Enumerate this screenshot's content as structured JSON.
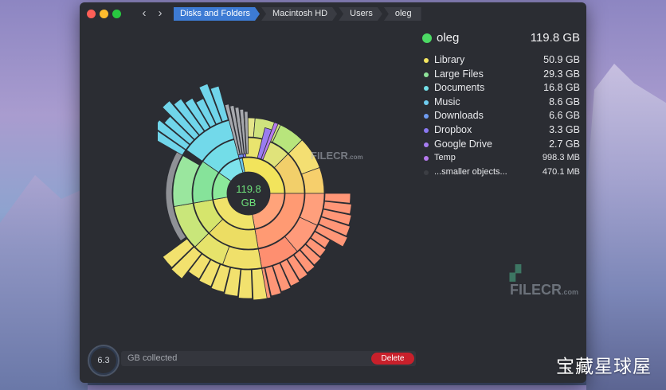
{
  "window": {
    "breadcrumbs": [
      "Disks and Folders",
      "Macintosh HD",
      "Users",
      "oleg"
    ],
    "back_icon": "chevron-left-icon",
    "forward_icon": "chevron-right-icon"
  },
  "chart": {
    "center_value": "119.8",
    "center_unit": "GB"
  },
  "legend": {
    "folder": {
      "name": "oleg",
      "size": "119.8 GB",
      "color": "#4cd964"
    },
    "items": [
      {
        "label": "Library",
        "size": "50.9 GB",
        "color": "#f5e660"
      },
      {
        "label": "Large Files",
        "size": "29.3 GB",
        "color": "#8fe39a"
      },
      {
        "label": "Documents",
        "size": "16.8 GB",
        "color": "#74e0ea"
      },
      {
        "label": "Music",
        "size": "8.6 GB",
        "color": "#6fcdf0"
      },
      {
        "label": "Downloads",
        "size": "6.6 GB",
        "color": "#6f9cf2"
      },
      {
        "label": "Dropbox",
        "size": "3.3 GB",
        "color": "#8a78f2"
      },
      {
        "label": "Google Drive",
        "size": "2.7 GB",
        "color": "#a77df2"
      },
      {
        "label": "Temp",
        "size": "998.3  MB",
        "color": "#b679ee"
      },
      {
        "label": "...smaller objects...",
        "size": "470.1  MB",
        "color": "#3c3e44"
      }
    ]
  },
  "collector": {
    "value": "6.3",
    "unit": "GB collected",
    "delete_label": "Delete"
  },
  "watermarks": {
    "center": "FILECR",
    "center_sub": ".com",
    "right": "FILECR",
    "right_sub": ".com",
    "corner": "宝藏星球屋"
  }
}
